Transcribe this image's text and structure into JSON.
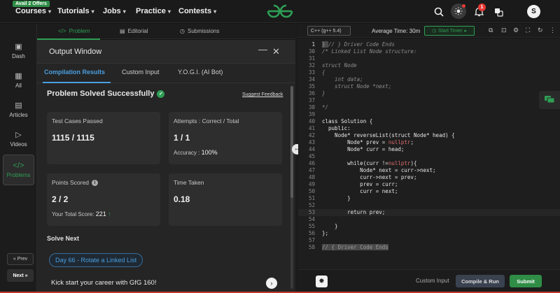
{
  "topnav": {
    "offer_badge": "Avail 2 Offers",
    "items": [
      "Courses",
      "Tutorials",
      "Jobs",
      "Practice",
      "Contests"
    ],
    "notification_count": "1",
    "avatar_letter": "S"
  },
  "sidebar": {
    "items": [
      {
        "label": "Dash",
        "icon": "dashboard-icon"
      },
      {
        "label": "All",
        "icon": "grid-icon"
      },
      {
        "label": "Articles",
        "icon": "article-icon"
      },
      {
        "label": "Videos",
        "icon": "video-icon"
      },
      {
        "label": "Problems",
        "icon": "code-icon"
      }
    ],
    "prev_label": "« Prev",
    "next_label": "Next »"
  },
  "panel_tabs": {
    "problem": "Problem",
    "editorial": "Editorial",
    "submissions": "Submissions"
  },
  "output_window": {
    "title": "Output Window",
    "tabs": [
      "Compilation Results",
      "Custom Input",
      "Y.O.G.I. (AI Bot)"
    ],
    "status": "Problem Solved Successfully",
    "suggest_feedback": "Suggest Feedback",
    "cards": {
      "test_cases_label": "Test Cases Passed",
      "test_cases_value": "1115 / 1115",
      "attempts_label": "Attempts : Correct / Total",
      "attempts_value": "1 / 1",
      "accuracy_label": "Accuracy :",
      "accuracy_value": "100%",
      "points_label": "Points Scored",
      "points_value": "2 / 2",
      "total_score_label": "Your Total Score:",
      "total_score_value": "221",
      "time_label": "Time Taken",
      "time_value": "0.18"
    },
    "solve_next_label": "Solve Next",
    "next_problem": "Day 66 - Rotate a Linked List",
    "kickstart": "Kick start your career with GfG 160!"
  },
  "editor": {
    "language": "C++ (g++ 5.4)",
    "avg_time_label": "Average Time:",
    "avg_time_value": "30m",
    "start_timer": "Start Timer",
    "lines": [
      {
        "n": "1",
        "segs": [
          [
            "sel",
            "} "
          ],
          [
            "cm",
            "// } Driver Code Ends"
          ]
        ]
      },
      {
        "n": "30",
        "segs": [
          [
            "cm",
            "/* Linked List Node structure:"
          ]
        ]
      },
      {
        "n": "31",
        "segs": [
          [
            "",
            ""
          ]
        ]
      },
      {
        "n": "32",
        "segs": [
          [
            "cm",
            "struct Node"
          ]
        ]
      },
      {
        "n": "33",
        "segs": [
          [
            "cm",
            "{"
          ]
        ]
      },
      {
        "n": "34",
        "segs": [
          [
            "cm",
            "    int data;"
          ]
        ]
      },
      {
        "n": "35",
        "segs": [
          [
            "cm",
            "    struct Node *next;"
          ]
        ]
      },
      {
        "n": "36",
        "segs": [
          [
            "cm",
            "}"
          ]
        ]
      },
      {
        "n": "37",
        "segs": [
          [
            "",
            ""
          ]
        ]
      },
      {
        "n": "38",
        "segs": [
          [
            "cm",
            "*/"
          ]
        ]
      },
      {
        "n": "39",
        "segs": [
          [
            "",
            ""
          ]
        ]
      },
      {
        "n": "40",
        "segs": [
          [
            "kw",
            "class Solution {"
          ]
        ]
      },
      {
        "n": "41",
        "segs": [
          [
            "kw",
            "  public:"
          ]
        ]
      },
      {
        "n": "42",
        "segs": [
          [
            "",
            "    Node* reverseList(struct Node* head) {"
          ]
        ]
      },
      {
        "n": "43",
        "segs": [
          [
            "",
            "        Node* prev = "
          ],
          [
            "nl",
            "nullptr"
          ],
          [
            "",
            ";"
          ]
        ]
      },
      {
        "n": "44",
        "segs": [
          [
            "",
            "        Node* curr = head;"
          ]
        ]
      },
      {
        "n": "45",
        "segs": [
          [
            "",
            ""
          ]
        ]
      },
      {
        "n": "46",
        "segs": [
          [
            "",
            "        while(curr !="
          ],
          [
            "nl",
            "nullptr"
          ],
          [
            "",
            "){"
          ]
        ]
      },
      {
        "n": "47",
        "segs": [
          [
            "",
            "            Node* next = curr->next;"
          ]
        ]
      },
      {
        "n": "48",
        "segs": [
          [
            "",
            "            curr->next = prev;"
          ]
        ]
      },
      {
        "n": "49",
        "segs": [
          [
            "",
            "            prev = curr;"
          ]
        ]
      },
      {
        "n": "50",
        "segs": [
          [
            "",
            "            curr = next;"
          ]
        ]
      },
      {
        "n": "51",
        "segs": [
          [
            "",
            "        }"
          ]
        ]
      },
      {
        "n": "52",
        "segs": [
          [
            "",
            ""
          ]
        ]
      },
      {
        "n": "53",
        "segs": [
          [
            "",
            "        return prev;"
          ]
        ]
      },
      {
        "n": "54",
        "segs": [
          [
            "",
            ""
          ]
        ]
      },
      {
        "n": "55",
        "segs": [
          [
            "",
            "    }"
          ]
        ]
      },
      {
        "n": "56",
        "segs": [
          [
            "",
            "};"
          ]
        ]
      },
      {
        "n": "57",
        "segs": [
          [
            "",
            ""
          ]
        ]
      },
      {
        "n": "58",
        "segs": [
          [
            "sel",
            "// { Driver Code Ends"
          ]
        ]
      }
    ],
    "custom_input": "Custom Input",
    "compile_run": "Compile & Run",
    "submit": "Submit"
  },
  "colors": {
    "brand_green": "#2f8d46",
    "accent_blue": "#4a9fe0",
    "danger_red": "#e53935"
  }
}
